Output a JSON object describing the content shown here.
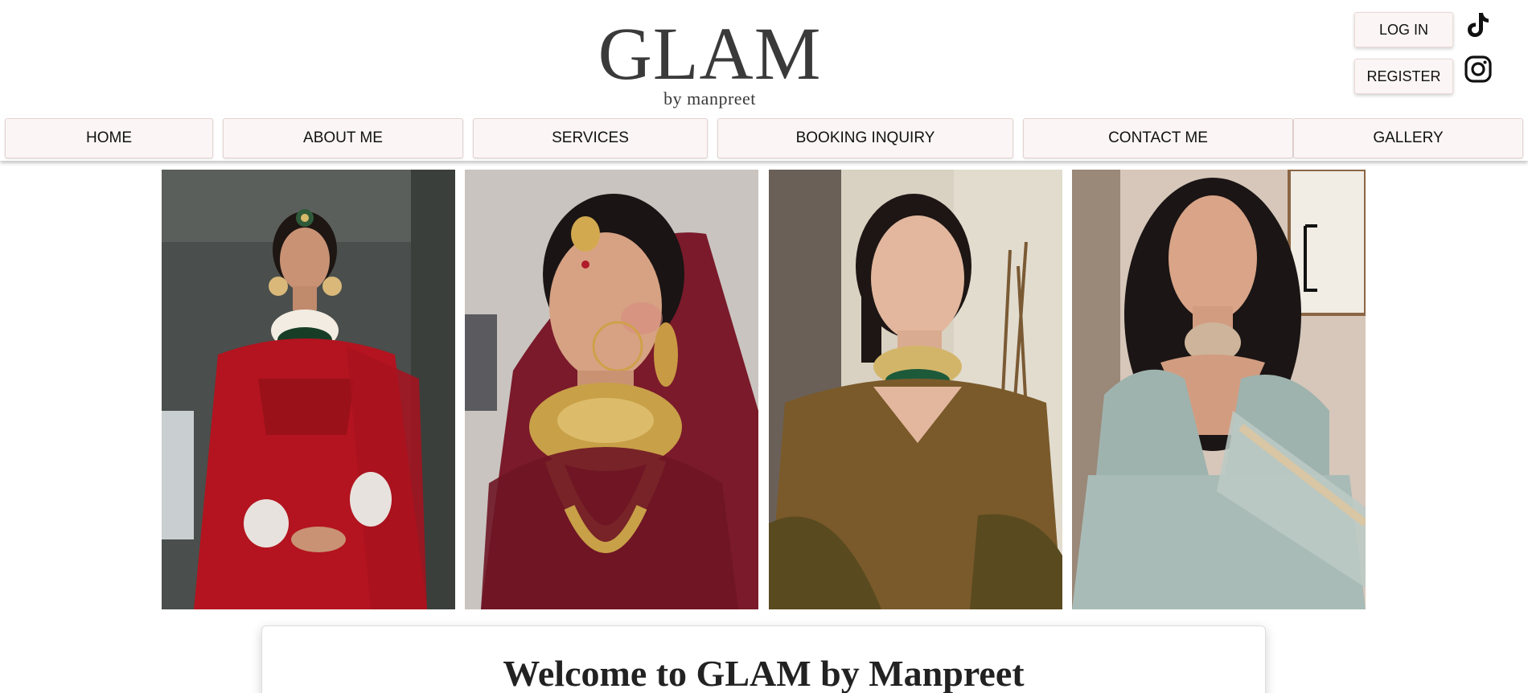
{
  "brand": {
    "name": "GLAM",
    "tagline": "by manpreet"
  },
  "auth": {
    "login_label": "LOG IN",
    "register_label": "REGISTER"
  },
  "social": {
    "tiktok_icon": "tiktok-icon",
    "instagram_icon": "instagram-icon"
  },
  "nav": {
    "items": [
      {
        "label": "HOME"
      },
      {
        "label": "ABOUT ME"
      },
      {
        "label": "SERVICES"
      },
      {
        "label": "BOOKING INQUIRY"
      },
      {
        "label": "CONTACT ME"
      },
      {
        "label": "GALLERY"
      }
    ]
  },
  "gallery": {
    "photos": [
      {
        "outfit_color": "#b3141f",
        "background_color": "#4a4e4c"
      },
      {
        "outfit_color": "#6e1524",
        "background_color": "#c9c4c0"
      },
      {
        "outfit_color": "#7a5a2a",
        "background_color": "#d9d2c2"
      },
      {
        "outfit_color": "#9fb3ae",
        "background_color": "#d6c7ba"
      }
    ]
  },
  "welcome": {
    "title": "Welcome to GLAM by Manpreet"
  },
  "colors": {
    "button_bg": "#fbf6f5",
    "button_border": "#e3d3d0",
    "logo": "#3a3a3a"
  }
}
